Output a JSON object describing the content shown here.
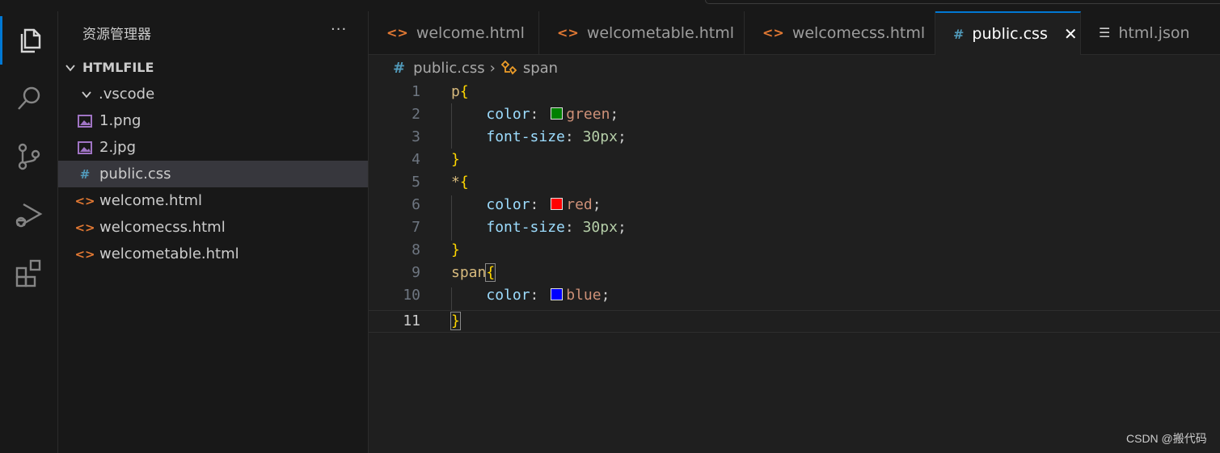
{
  "explorer": {
    "title": "资源管理器",
    "more": "···",
    "folder": "HTMLFILE",
    "items": [
      {
        "label": ".vscode",
        "type": "folder"
      },
      {
        "label": "1.png",
        "type": "image"
      },
      {
        "label": "2.jpg",
        "type": "image"
      },
      {
        "label": "public.css",
        "type": "css",
        "selected": true
      },
      {
        "label": "welcome.html",
        "type": "html"
      },
      {
        "label": "welcomecss.html",
        "type": "html"
      },
      {
        "label": "welcometable.html",
        "type": "html"
      }
    ]
  },
  "tabs": [
    {
      "label": "welcome.html",
      "icon": "html-icon"
    },
    {
      "label": "welcometable.html",
      "icon": "html-icon"
    },
    {
      "label": "welcomecss.html",
      "icon": "html-icon"
    },
    {
      "label": "public.css",
      "icon": "css-icon",
      "active": true
    },
    {
      "label": "html.json",
      "icon": "json-icon"
    }
  ],
  "breadcrumb": {
    "file": "public.css",
    "symbol": "span"
  },
  "editor": {
    "current_line": 11,
    "lines": [
      {
        "n": "1",
        "selector": "p",
        "brace": "{"
      },
      {
        "n": "2",
        "prop": "color",
        "value": "green",
        "swatch": "#008000"
      },
      {
        "n": "3",
        "prop": "font-size",
        "value": "30px",
        "numeric": true
      },
      {
        "n": "4",
        "close": "}"
      },
      {
        "n": "5",
        "selector": "*",
        "brace": "{"
      },
      {
        "n": "6",
        "prop": "color",
        "value": "red",
        "swatch": "#ff0000"
      },
      {
        "n": "7",
        "prop": "font-size",
        "value": "30px",
        "numeric": true
      },
      {
        "n": "8",
        "close": "}"
      },
      {
        "n": "9",
        "selector": "span",
        "brace": "{"
      },
      {
        "n": "10",
        "prop": "color",
        "value": "blue",
        "swatch": "#0000ff"
      },
      {
        "n": "11",
        "close": "}"
      }
    ]
  },
  "watermark": "CSDN @搬代码",
  "colors": {
    "accent": "#0078d4",
    "html_icon": "#e37933",
    "css_icon": "#519aba",
    "image_icon": "#a074c4"
  }
}
